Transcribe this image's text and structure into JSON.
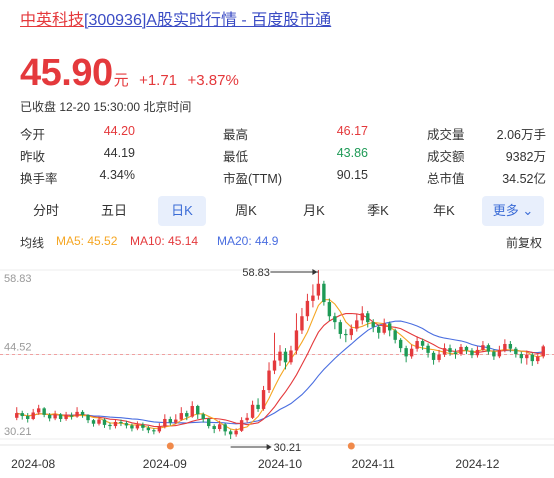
{
  "page": {
    "title_name": "中英科技",
    "title_code": "[300936]",
    "title_rest": "A股实时行情 - 百度股市通"
  },
  "quote": {
    "price": "45.90",
    "unit": "元",
    "change": "+1.71",
    "change_pct": "+3.87%",
    "status": "已收盘 12-20 15:30:00 北京时间"
  },
  "stats": [
    [
      {
        "label": "今开",
        "value": "44.20",
        "tone": "up"
      },
      {
        "label": "最高",
        "value": "46.17",
        "tone": "up"
      },
      {
        "label": "成交量",
        "value": "2.06万手",
        "tone": "neutral"
      }
    ],
    [
      {
        "label": "昨收",
        "value": "44.19",
        "tone": "neutral"
      },
      {
        "label": "最低",
        "value": "43.86",
        "tone": "down"
      },
      {
        "label": "成交额",
        "value": "9382万",
        "tone": "neutral"
      }
    ],
    [
      {
        "label": "换手率",
        "value": "4.34%",
        "tone": "neutral"
      },
      {
        "label": "市盈(TTM)",
        "value": "90.15",
        "tone": "neutral"
      },
      {
        "label": "总市值",
        "value": "34.52亿",
        "tone": "neutral"
      }
    ]
  ],
  "tabs": [
    "分时",
    "五日",
    "日K",
    "周K",
    "月K",
    "季K",
    "年K"
  ],
  "active_tab": "日K",
  "more_label": "更多",
  "ma": {
    "label": "均线",
    "ma5": "MA5: 45.52",
    "ma10": "MA10: 45.14",
    "ma20": "MA20: 44.9",
    "adjust": "前复权"
  },
  "colors": {
    "up": "#e4393c",
    "down": "#1e9a56",
    "ma5": "#f5a623",
    "ma10": "#e4393c",
    "ma20": "#4a6ee0",
    "brand": "#3a4bc4"
  },
  "chart_data": {
    "type": "candlestick",
    "ylim": [
      30.21,
      58.83
    ],
    "y_labels": [
      "58.83",
      "44.52",
      "30.21"
    ],
    "reference_line": 44.52,
    "x_labels": [
      "2024-08",
      "2024-09",
      "2024-10",
      "2024-11",
      "2024-12"
    ],
    "x_label_index": [
      3,
      27,
      48,
      65,
      84
    ],
    "annotations": [
      {
        "text": "58.83",
        "index": 55,
        "value": 58.83,
        "side": "left"
      },
      {
        "text": "30.21",
        "index": 39,
        "value": 30.21,
        "side": "right"
      }
    ],
    "event_markers": [
      28,
      61
    ],
    "candles": [
      [
        33.8,
        34.6,
        35.6,
        33.4
      ],
      [
        34.6,
        34.1,
        35.0,
        33.5
      ],
      [
        34.1,
        33.6,
        34.6,
        33.0
      ],
      [
        33.6,
        34.7,
        35.3,
        33.4
      ],
      [
        34.7,
        35.4,
        36.0,
        34.3
      ],
      [
        35.4,
        34.3,
        35.6,
        33.9
      ],
      [
        34.3,
        33.7,
        34.6,
        33.2
      ],
      [
        33.7,
        34.4,
        35.0,
        33.4
      ],
      [
        34.4,
        33.6,
        34.6,
        33.1
      ],
      [
        33.6,
        34.2,
        34.8,
        33.3
      ],
      [
        34.2,
        34.0,
        34.7,
        33.5
      ],
      [
        34.0,
        34.8,
        35.6,
        33.8
      ],
      [
        34.8,
        34.3,
        35.1,
        33.8
      ],
      [
        34.3,
        33.4,
        34.4,
        32.9
      ],
      [
        33.4,
        32.8,
        33.6,
        32.3
      ],
      [
        32.8,
        33.5,
        34.0,
        32.5
      ],
      [
        33.5,
        32.6,
        33.7,
        32.1
      ],
      [
        32.6,
        32.4,
        33.0,
        31.8
      ],
      [
        32.4,
        33.1,
        33.6,
        32.0
      ],
      [
        33.1,
        32.9,
        33.5,
        32.4
      ],
      [
        32.9,
        32.5,
        33.3,
        32.0
      ],
      [
        32.5,
        32.0,
        32.8,
        31.5
      ],
      [
        32.0,
        32.6,
        33.2,
        31.7
      ],
      [
        32.6,
        32.1,
        33.0,
        31.6
      ],
      [
        32.1,
        31.7,
        32.4,
        31.2
      ],
      [
        31.7,
        31.5,
        32.0,
        31.0
      ],
      [
        31.5,
        32.3,
        32.9,
        31.2
      ],
      [
        32.3,
        33.6,
        34.4,
        32.0
      ],
      [
        33.6,
        33.0,
        34.0,
        32.5
      ],
      [
        33.0,
        33.5,
        34.4,
        32.7
      ],
      [
        33.5,
        34.6,
        35.6,
        33.3
      ],
      [
        34.6,
        34.0,
        35.0,
        33.4
      ],
      [
        34.0,
        35.8,
        36.6,
        33.8
      ],
      [
        35.8,
        34.4,
        36.0,
        33.6
      ],
      [
        34.4,
        33.6,
        34.7,
        33.0
      ],
      [
        33.6,
        32.4,
        33.8,
        32.0
      ],
      [
        32.4,
        31.9,
        32.7,
        31.2
      ],
      [
        31.9,
        32.7,
        33.3,
        31.5
      ],
      [
        32.7,
        31.5,
        32.9,
        30.8
      ],
      [
        31.5,
        31.0,
        31.8,
        30.21
      ],
      [
        31.0,
        31.6,
        32.0,
        30.6
      ],
      [
        31.6,
        33.4,
        33.9,
        31.4
      ],
      [
        33.4,
        33.8,
        34.6,
        33.0
      ],
      [
        33.8,
        36.0,
        36.7,
        33.6
      ],
      [
        36.0,
        35.3,
        37.1,
        34.8
      ],
      [
        35.3,
        38.5,
        39.2,
        35.0
      ],
      [
        38.5,
        41.8,
        43.2,
        38.0
      ],
      [
        41.8,
        43.5,
        48.2,
        41.2
      ],
      [
        43.5,
        45.0,
        46.1,
        42.6
      ],
      [
        45.0,
        43.2,
        45.6,
        42.0
      ],
      [
        43.2,
        45.2,
        46.0,
        42.8
      ],
      [
        45.2,
        48.6,
        51.5,
        44.6
      ],
      [
        48.6,
        51.0,
        52.4,
        48.0
      ],
      [
        51.0,
        53.6,
        54.8,
        50.2
      ],
      [
        53.6,
        54.5,
        56.4,
        52.5
      ],
      [
        54.5,
        56.5,
        58.83,
        53.8
      ],
      [
        56.5,
        53.4,
        57.0,
        52.8
      ],
      [
        53.4,
        51.0,
        54.0,
        50.2
      ],
      [
        51.0,
        50.0,
        51.6,
        48.8
      ],
      [
        50.0,
        48.0,
        50.4,
        47.2
      ],
      [
        48.0,
        47.8,
        48.8,
        46.6
      ],
      [
        47.8,
        48.9,
        49.6,
        47.0
      ],
      [
        48.9,
        50.3,
        51.4,
        48.4
      ],
      [
        50.3,
        51.5,
        52.7,
        49.6
      ],
      [
        51.5,
        50.0,
        51.9,
        49.1
      ],
      [
        50.0,
        49.2,
        50.5,
        48.3
      ],
      [
        49.2,
        48.2,
        49.6,
        47.2
      ],
      [
        48.2,
        49.8,
        50.6,
        47.9
      ],
      [
        49.8,
        48.6,
        50.1,
        47.6
      ],
      [
        48.6,
        47.0,
        48.9,
        46.4
      ],
      [
        47.0,
        45.6,
        47.3,
        44.9
      ],
      [
        45.6,
        44.2,
        46.0,
        43.2
      ],
      [
        44.2,
        45.5,
        46.2,
        43.8
      ],
      [
        45.5,
        46.8,
        47.6,
        45.0
      ],
      [
        46.8,
        46.0,
        47.2,
        45.3
      ],
      [
        46.0,
        44.8,
        46.4,
        44.0
      ],
      [
        44.8,
        43.6,
        45.1,
        42.8
      ],
      [
        43.6,
        44.5,
        45.3,
        43.2
      ],
      [
        44.5,
        45.6,
        46.4,
        44.1
      ],
      [
        45.6,
        44.9,
        46.2,
        44.3
      ],
      [
        44.9,
        44.6,
        45.5,
        43.8
      ],
      [
        44.6,
        45.8,
        46.3,
        44.3
      ],
      [
        45.8,
        45.2,
        46.0,
        44.6
      ],
      [
        45.2,
        44.4,
        45.6,
        43.9
      ],
      [
        44.4,
        45.3,
        45.9,
        44.0
      ],
      [
        45.3,
        46.1,
        46.8,
        45.0
      ],
      [
        46.1,
        45.0,
        46.4,
        44.5
      ],
      [
        45.0,
        44.2,
        45.4,
        43.6
      ],
      [
        44.2,
        45.3,
        46.0,
        43.9
      ],
      [
        45.3,
        46.3,
        47.1,
        44.9
      ],
      [
        46.3,
        45.5,
        46.8,
        44.9
      ],
      [
        45.5,
        44.6,
        45.8,
        44.0
      ],
      [
        44.6,
        43.9,
        45.0,
        43.0
      ],
      [
        43.9,
        44.5,
        45.2,
        42.8
      ],
      [
        44.5,
        43.4,
        44.8,
        42.6
      ],
      [
        43.4,
        44.19,
        44.7,
        42.9
      ],
      [
        44.2,
        45.9,
        46.17,
        43.86
      ]
    ]
  }
}
